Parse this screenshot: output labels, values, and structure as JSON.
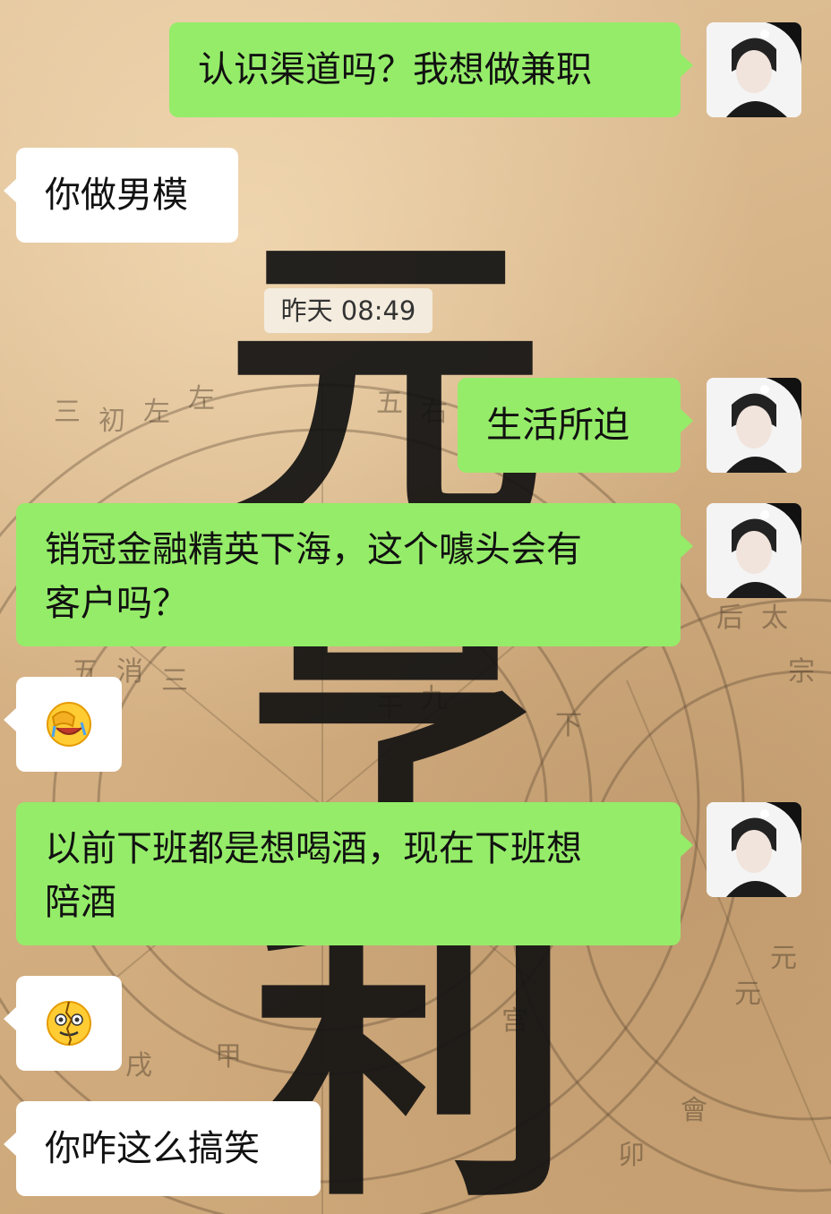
{
  "chat": {
    "timestamp": "昨天 08:49",
    "messages": [
      {
        "side": "out",
        "text": "认识渠道吗？我想做兼职"
      },
      {
        "side": "in",
        "text": "你做男模"
      },
      {
        "side": "out",
        "text": "生活所迫"
      },
      {
        "side": "out",
        "text": "销冠金融精英下海，这个噱头会有",
        "text2": "客户吗？"
      },
      {
        "side": "in",
        "emoji": "facepalm-crying-emoji"
      },
      {
        "side": "out",
        "text": "以前下班都是想喝酒，现在下班想",
        "text2": "陪酒"
      },
      {
        "side": "in",
        "emoji": "cracked-smile-emoji"
      },
      {
        "side": "in",
        "text": "你咋这么搞笑"
      }
    ]
  },
  "background": {
    "calligraphy": [
      "元",
      "亨",
      "利"
    ]
  },
  "colors": {
    "outgoing_bubble": "#95ec69",
    "incoming_bubble": "#ffffff",
    "timestamp_bg": "#f5f0e6"
  }
}
